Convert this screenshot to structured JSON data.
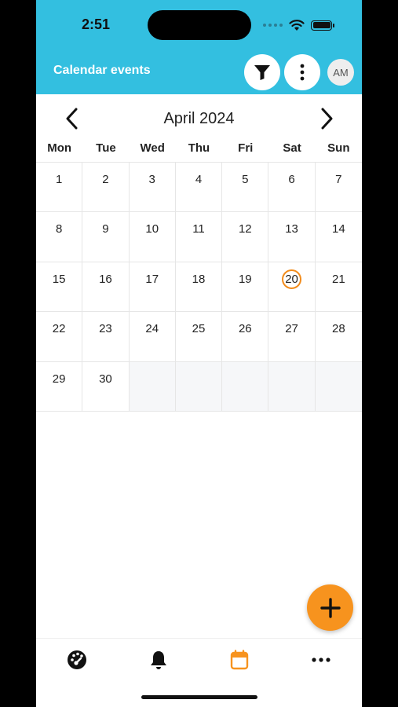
{
  "status_bar": {
    "time": "2:51"
  },
  "header": {
    "title": "Calendar events",
    "avatar_initials": "AM",
    "background_color": "#33bfe0"
  },
  "calendar": {
    "month_label": "April 2024",
    "weekdays": [
      "Mon",
      "Tue",
      "Wed",
      "Thu",
      "Fri",
      "Sat",
      "Sun"
    ],
    "days": [
      "1",
      "2",
      "3",
      "4",
      "5",
      "6",
      "7",
      "8",
      "9",
      "10",
      "11",
      "12",
      "13",
      "14",
      "15",
      "16",
      "17",
      "18",
      "19",
      "20",
      "21",
      "22",
      "23",
      "24",
      "25",
      "26",
      "27",
      "28",
      "29",
      "30",
      "",
      "",
      "",
      "",
      ""
    ],
    "today": "20",
    "today_ring_color": "#f28c1c"
  },
  "fab": {
    "icon": "plus-icon",
    "color": "#f7931e"
  },
  "tabbar": {
    "items": [
      {
        "icon": "dashboard-icon"
      },
      {
        "icon": "bell-icon"
      },
      {
        "icon": "calendar-icon",
        "active": true,
        "active_color": "#f7931e"
      },
      {
        "icon": "more-horizontal-icon"
      }
    ]
  }
}
